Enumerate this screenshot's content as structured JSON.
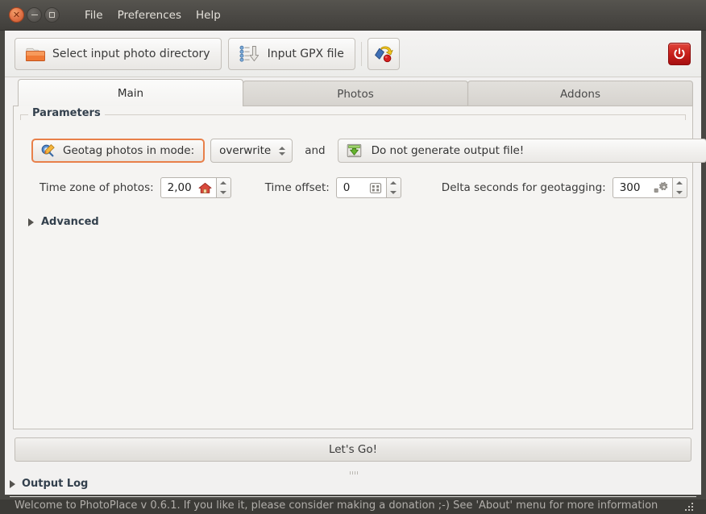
{
  "window": {
    "controls": {
      "close": "close-button",
      "minimize": "minimize-button",
      "maximize": "maximize-button"
    },
    "menu": [
      "File",
      "Preferences",
      "Help"
    ]
  },
  "toolbar": {
    "select_dir_label": "Select input photo directory",
    "input_gpx_label": "Input GPX file",
    "variables_icon": "variables-icon",
    "quit_icon": "power-icon"
  },
  "tabs": [
    {
      "label": "Main",
      "active": true
    },
    {
      "label": "Photos",
      "active": false
    },
    {
      "label": "Addons",
      "active": false
    }
  ],
  "parameters": {
    "frame_title": "Parameters",
    "geotag": {
      "button_label": "Geotag photos in mode:",
      "mode_value": "overwrite",
      "conjunction": "and",
      "output_label": "Do not generate output file!"
    },
    "fields": [
      {
        "label": "Time zone of photos:",
        "value": "2,00",
        "icon": "home-icon"
      },
      {
        "label": "Time offset:",
        "value": "0",
        "icon": "clock-icon"
      },
      {
        "label": "Delta seconds for geotagging:",
        "value": "300",
        "icon": "gears-icon"
      }
    ],
    "advanced_label": "Advanced"
  },
  "actions": {
    "go_label": "Let's Go!",
    "output_log_label": "Output Log"
  },
  "statusbar": {
    "message": "Welcome to PhotoPlace v 0.6.1. If you like it, please consider making a donation ;-) See 'About' menu for more information"
  },
  "colors": {
    "accent_orange": "#e8804a",
    "titlebar": "#4a4844",
    "frame_bg": "#f5f4f2",
    "quit_red": "#c71f1a",
    "heading_blue": "#33404d"
  }
}
